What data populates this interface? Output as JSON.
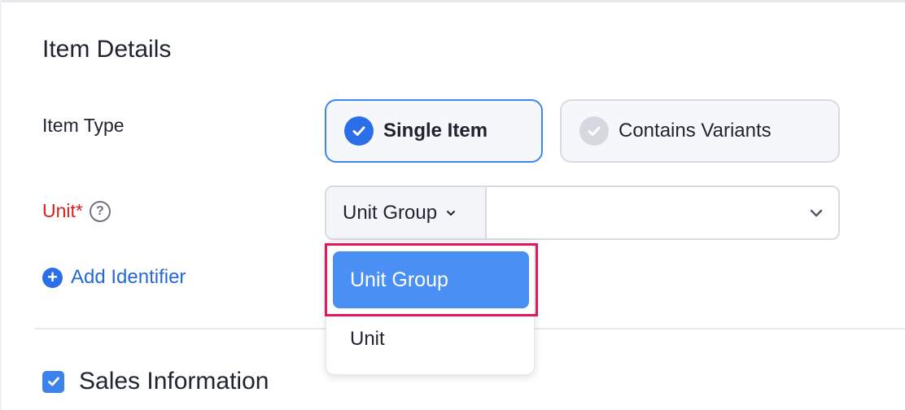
{
  "section": {
    "title": "Item Details"
  },
  "item_type": {
    "label": "Item Type",
    "options": [
      {
        "label": "Single Item",
        "selected": true,
        "icon": "check-circle-icon"
      },
      {
        "label": "Contains Variants",
        "selected": false,
        "icon": "check-circle-icon"
      }
    ]
  },
  "unit": {
    "label": "Unit*",
    "help_icon_glyph": "?",
    "select_value": "Unit Group",
    "field_value": ""
  },
  "dropdown": {
    "options": [
      "Unit Group",
      "Unit"
    ],
    "active": "Unit Group",
    "highlight_color": "#e3185a"
  },
  "add_identifier": {
    "label": "Add Identifier",
    "icon_glyph": "+"
  },
  "sales_information": {
    "label": "Sales Information",
    "checked": true
  },
  "colors": {
    "accent": "#2a6ee8",
    "required_label": "#d2221d",
    "dropdown_active_bg": "#4a8ff3"
  }
}
